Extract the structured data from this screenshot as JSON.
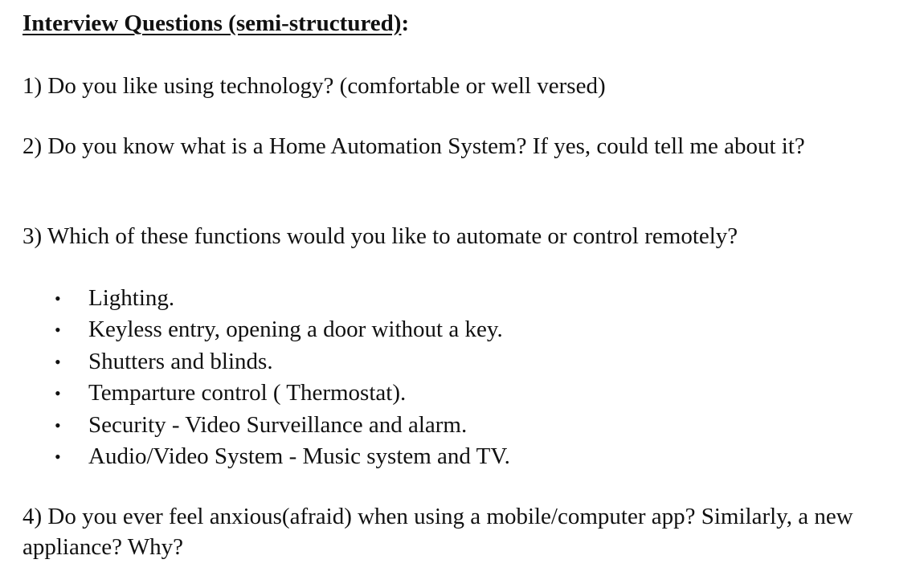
{
  "document": {
    "heading_title": "Interview Questions (semi-structured)",
    "heading_colon": ":",
    "questions": [
      "1) Do you like using technology? (comfortable or well versed)",
      "2) Do you know what is a Home Automation System? If yes, could tell me about it?",
      "3) Which of these functions would you like to automate or control remotely?",
      "4) Do you ever feel anxious(afraid) when using a mobile/computer app? Similarly, a new appliance? Why?"
    ],
    "functions": [
      "Lighting.",
      "Keyless entry, opening a door without a key.",
      "Shutters and blinds.",
      "Temparture control ( Thermostat).",
      "Security - Video Surveillance and alarm.",
      "Audio/Video System - Music system and TV."
    ],
    "bullet_glyph": "•"
  }
}
